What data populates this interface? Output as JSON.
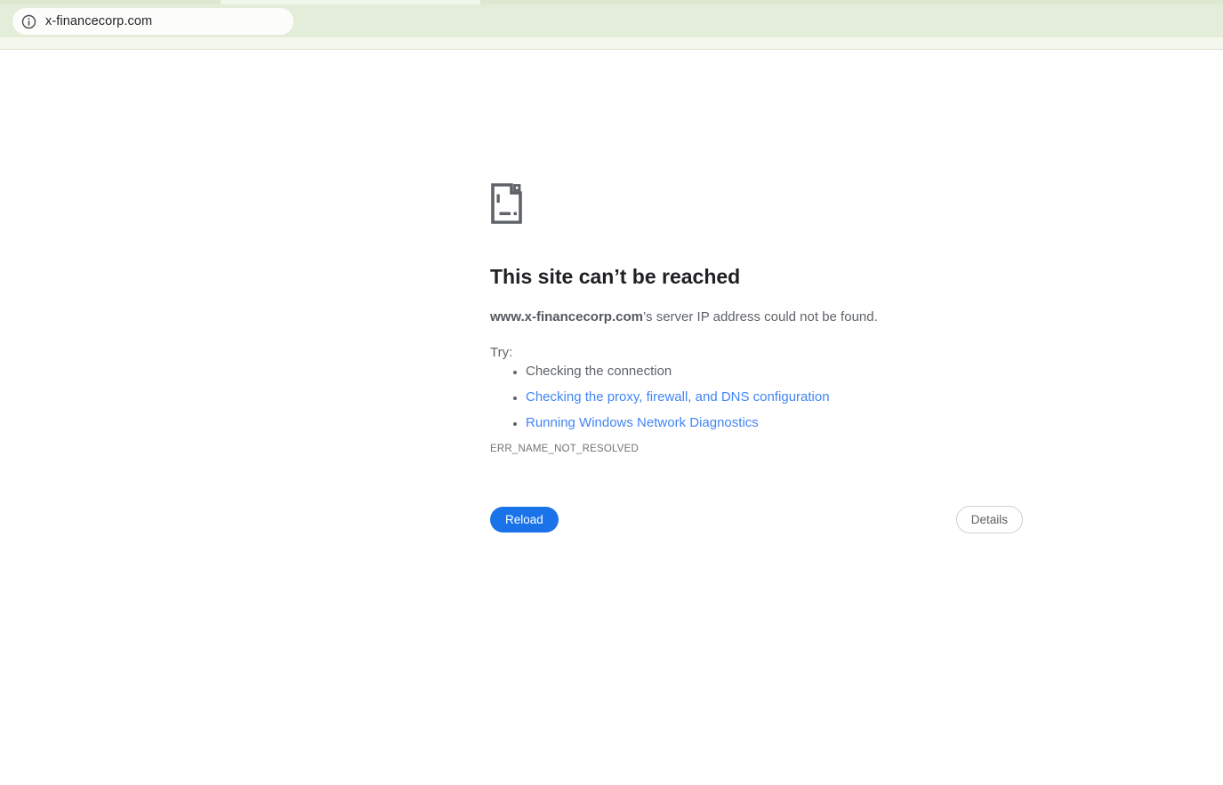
{
  "browser": {
    "url": "x-financecorp.com",
    "info_icon": "page-info-icon"
  },
  "error_page": {
    "title": "This site can’t be reached",
    "domain": "www.x-financecorp.com",
    "message_suffix": "’s server IP address could not be found.",
    "try_label": "Try:",
    "suggestions": [
      {
        "label": "Checking the connection",
        "is_link": false
      },
      {
        "label": "Checking the proxy, firewall, and DNS configuration",
        "is_link": true
      },
      {
        "label": "Running Windows Network Diagnostics",
        "is_link": true
      }
    ],
    "error_code": "ERR_NAME_NOT_RESOLVED",
    "reload_label": "Reload",
    "details_label": "Details"
  },
  "colors": {
    "toolbar_green": "#e4ecda",
    "tab_strip_green": "#dde8d1",
    "bookmarks_band": "#f4f8ec",
    "link_blue": "#4285f4",
    "reload_blue": "#1a73e8",
    "text_dark": "#202124",
    "text_gray": "#5f6368"
  }
}
